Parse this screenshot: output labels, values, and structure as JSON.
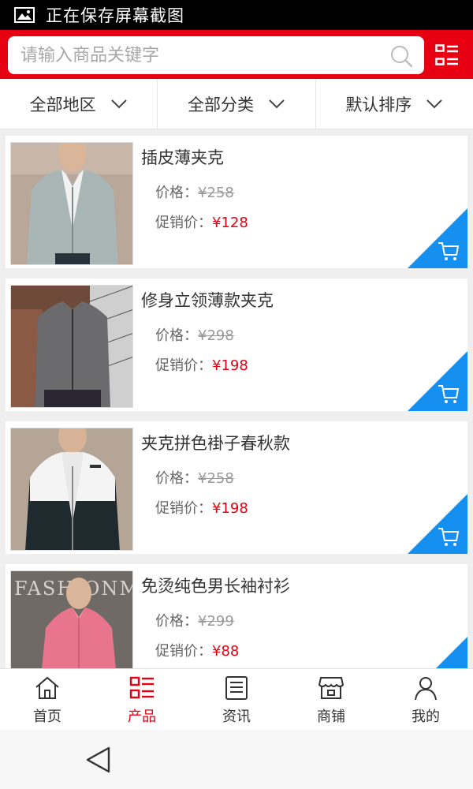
{
  "status_bar": {
    "text": "正在保存屏幕截图"
  },
  "search": {
    "placeholder": "请输入商品关键字"
  },
  "filters": [
    {
      "label": "全部地区"
    },
    {
      "label": "全部分类"
    },
    {
      "label": "默认排序"
    }
  ],
  "products": [
    {
      "title": "插皮薄夹克",
      "price_label": "价格：",
      "price": "¥258",
      "promo_label": "促销价：",
      "promo_price": "¥128",
      "image": "light-grey-jacket"
    },
    {
      "title": "修身立领薄款夹克",
      "price_label": "价格：",
      "price": "¥298",
      "promo_label": "促销价：",
      "promo_price": "¥198",
      "image": "dark-grey-jacket"
    },
    {
      "title": "夹克拼色褂子春秋款",
      "price_label": "价格：",
      "price": "¥258",
      "promo_label": "促销价：",
      "promo_price": "¥198",
      "image": "black-white-jacket"
    },
    {
      "title": "免烫纯色男长袖衬衫",
      "price_label": "价格：",
      "price": "¥299",
      "promo_label": "促销价：",
      "promo_price": "¥88",
      "image": "pink-shirt",
      "banner_text": "FASHIONMAN"
    }
  ],
  "bottom_nav": [
    {
      "label": "首页",
      "icon": "home-icon"
    },
    {
      "label": "产品",
      "icon": "product-list-icon",
      "active": true
    },
    {
      "label": "资讯",
      "icon": "news-icon"
    },
    {
      "label": "商铺",
      "icon": "store-icon"
    },
    {
      "label": "我的",
      "icon": "user-icon"
    }
  ],
  "colors": {
    "brand": "#e60012",
    "cart": "#1590f0",
    "price": "#e60012"
  }
}
